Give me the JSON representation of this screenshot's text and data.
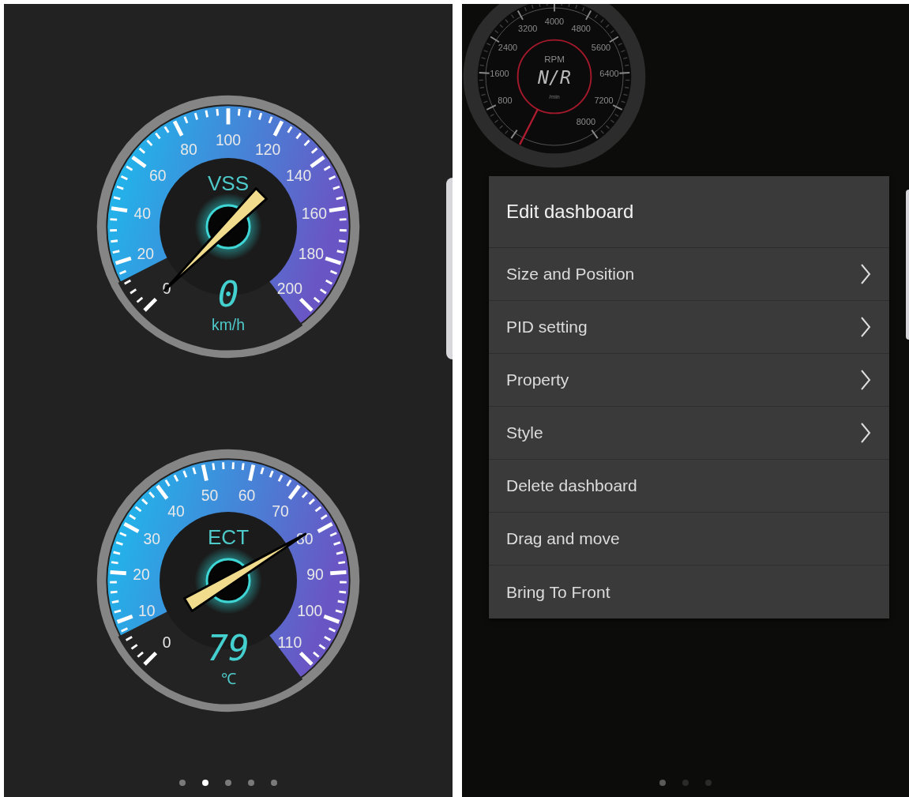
{
  "panels": [
    {
      "kind": "gauges",
      "gauges": [
        {
          "kind": "blue",
          "title": "VSS",
          "reading": "0",
          "unit": "km/h",
          "scale": [
            "100",
            "80",
            "120",
            "60",
            "140",
            "40",
            "160",
            "20",
            "180",
            "0",
            "200"
          ]
        },
        {
          "kind": "blue",
          "title": "ECT",
          "reading": "79",
          "unit": "℃",
          "scale": [
            "50",
            "60",
            "40",
            "70",
            "30",
            "80",
            "20",
            "90",
            "10",
            "100",
            "0",
            "110"
          ]
        }
      ],
      "page_dots": [
        {
          "selected": false
        },
        {
          "selected": true
        },
        {
          "selected": false
        },
        {
          "selected": false
        },
        {
          "selected": false
        }
      ]
    },
    {
      "kind": "menu",
      "gauges": [
        {
          "kind": "dark",
          "title": "RPM",
          "reading": "N/R",
          "unit": "/min",
          "scale": [
            "4000",
            "3200",
            "4800",
            "2400",
            "5600",
            "1600",
            "6400",
            "800",
            "7200",
            "8000"
          ]
        }
      ],
      "menu": {
        "title": "Edit dashboard",
        "items": [
          {
            "label": "Size and Position",
            "has_submenu": true
          },
          {
            "label": "PID setting",
            "has_submenu": true
          },
          {
            "label": "Property",
            "has_submenu": true
          },
          {
            "label": "Style",
            "has_submenu": true
          },
          {
            "label": "Delete dashboard",
            "has_submenu": false
          },
          {
            "label": "Drag and move",
            "has_submenu": false
          },
          {
            "label": "Bring To Front",
            "has_submenu": false
          }
        ]
      },
      "page_dots": [
        {
          "selected": true
        },
        {
          "selected": false
        },
        {
          "selected": false
        }
      ]
    }
  ]
}
